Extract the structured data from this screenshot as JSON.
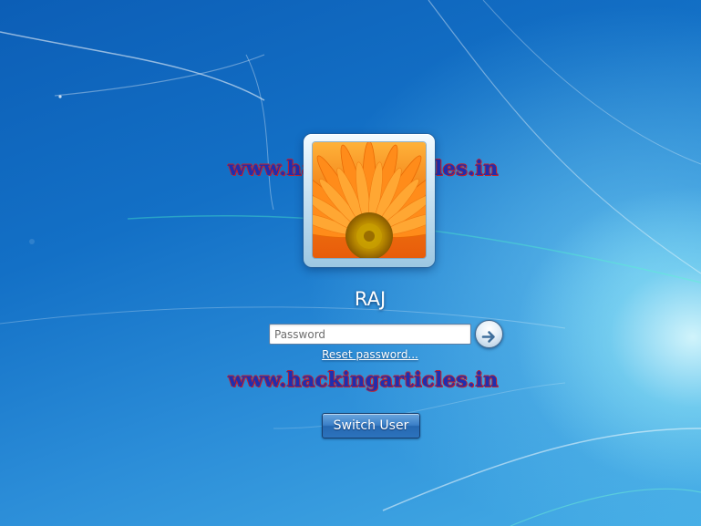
{
  "watermarks": {
    "top": "www.hackingarticles.in",
    "bottom": "www.hackingarticles.in"
  },
  "user": {
    "name": "RAJ",
    "avatar": "orange-gerbera-flower-picture"
  },
  "login": {
    "password_placeholder": "Password",
    "password_value": "",
    "submit_icon": "arrow-right-icon",
    "reset_link": "Reset password..."
  },
  "actions": {
    "switch_user": "Switch User"
  },
  "colors": {
    "background": "#1a78c8",
    "watermark_text": "#1d2fb0",
    "watermark_outline": "#c4202a",
    "switch_button": "#2c73bd"
  }
}
